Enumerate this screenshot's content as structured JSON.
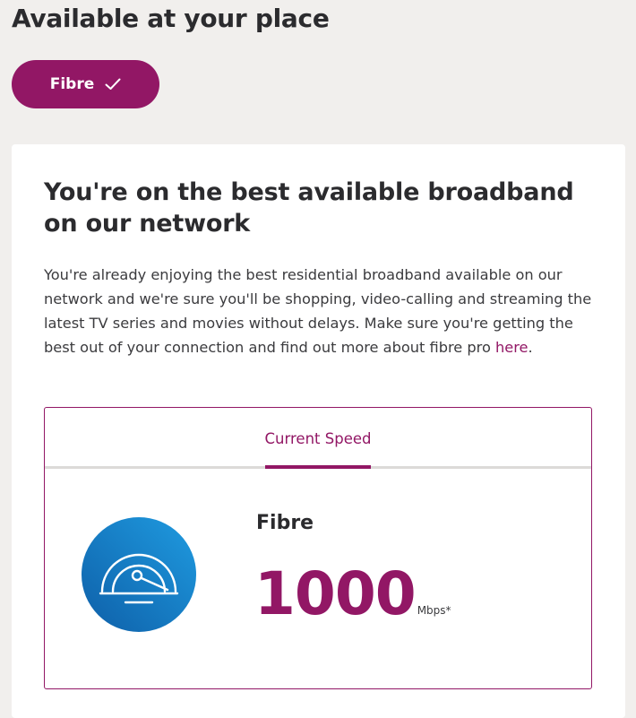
{
  "header": {
    "title": "Available at your place"
  },
  "technology_pill": {
    "label": "Fibre",
    "icon": "checkmark-icon",
    "selected": true
  },
  "card": {
    "heading": "You're on the best available broadband on our network",
    "body_text": "You're already enjoying the best residential broadband available on our network and we're sure you'll be shopping, video-calling and streaming the latest TV series and movies without delays. Make sure you're getting the best out of your connection and find out more about fibre pro ",
    "link_label": "here",
    "body_end": "."
  },
  "speed_panel": {
    "tab_label": "Current Speed",
    "icon": "speedometer-icon",
    "plan_name": "Fibre",
    "speed_value": "1000",
    "speed_unit": "Mbps*"
  },
  "colors": {
    "brand": "#921765",
    "background": "#f1efed",
    "icon_gradient_start": "#1f9be0",
    "icon_gradient_end": "#0e5fa8"
  }
}
